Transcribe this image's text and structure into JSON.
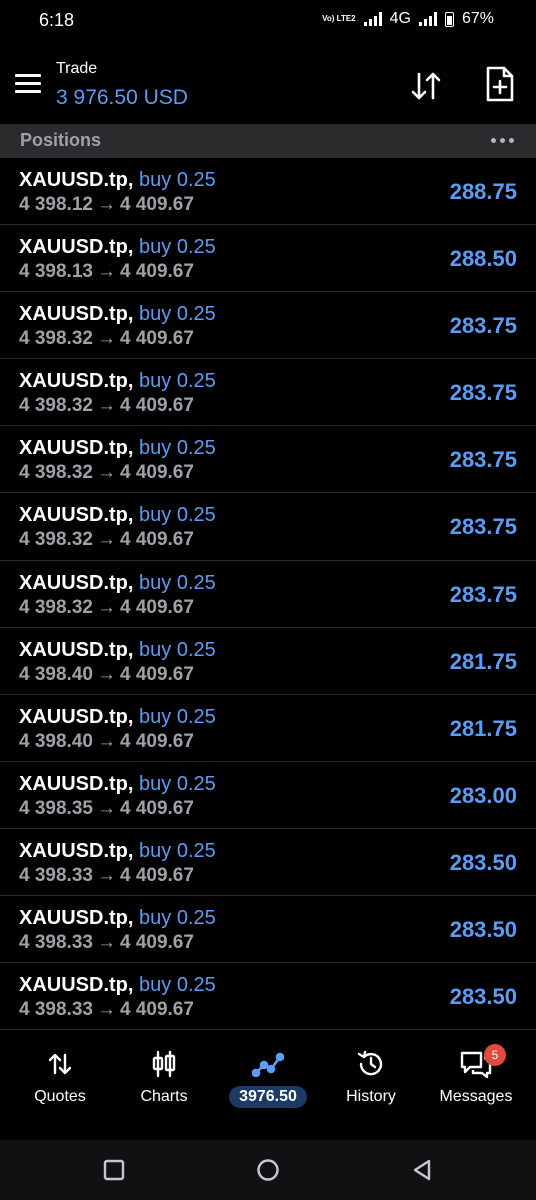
{
  "status_bar": {
    "time": "6:18",
    "volte_label": "Vo) LTE2",
    "network": "4G",
    "battery": "67%"
  },
  "header": {
    "title": "Trade",
    "balance": "3 976.50 USD"
  },
  "section": {
    "title": "Positions"
  },
  "positions": [
    {
      "symbol": "XAUUSD.tp,",
      "side": "buy 0.25",
      "open_price": "4 398.12",
      "current_price": "4 409.67",
      "profit": "288.75"
    },
    {
      "symbol": "XAUUSD.tp,",
      "side": "buy 0.25",
      "open_price": "4 398.13",
      "current_price": "4 409.67",
      "profit": "288.50"
    },
    {
      "symbol": "XAUUSD.tp,",
      "side": "buy 0.25",
      "open_price": "4 398.32",
      "current_price": "4 409.67",
      "profit": "283.75"
    },
    {
      "symbol": "XAUUSD.tp,",
      "side": "buy 0.25",
      "open_price": "4 398.32",
      "current_price": "4 409.67",
      "profit": "283.75"
    },
    {
      "symbol": "XAUUSD.tp,",
      "side": "buy 0.25",
      "open_price": "4 398.32",
      "current_price": "4 409.67",
      "profit": "283.75"
    },
    {
      "symbol": "XAUUSD.tp,",
      "side": "buy 0.25",
      "open_price": "4 398.32",
      "current_price": "4 409.67",
      "profit": "283.75"
    },
    {
      "symbol": "XAUUSD.tp,",
      "side": "buy 0.25",
      "open_price": "4 398.32",
      "current_price": "4 409.67",
      "profit": "283.75"
    },
    {
      "symbol": "XAUUSD.tp,",
      "side": "buy 0.25",
      "open_price": "4 398.40",
      "current_price": "4 409.67",
      "profit": "281.75"
    },
    {
      "symbol": "XAUUSD.tp,",
      "side": "buy 0.25",
      "open_price": "4 398.40",
      "current_price": "4 409.67",
      "profit": "281.75"
    },
    {
      "symbol": "XAUUSD.tp,",
      "side": "buy 0.25",
      "open_price": "4 398.35",
      "current_price": "4 409.67",
      "profit": "283.00"
    },
    {
      "symbol": "XAUUSD.tp,",
      "side": "buy 0.25",
      "open_price": "4 398.33",
      "current_price": "4 409.67",
      "profit": "283.50"
    },
    {
      "symbol": "XAUUSD.tp,",
      "side": "buy 0.25",
      "open_price": "4 398.33",
      "current_price": "4 409.67",
      "profit": "283.50"
    },
    {
      "symbol": "XAUUSD.tp,",
      "side": "buy 0.25",
      "open_price": "4 398.33",
      "current_price": "4 409.67",
      "profit": "283.50"
    }
  ],
  "bottom_nav": {
    "quotes_label": "Quotes",
    "charts_label": "Charts",
    "trade_label": "3976.50",
    "history_label": "History",
    "messages_label": "Messages",
    "messages_badge": "5"
  },
  "icons": {
    "menu": "menu-icon",
    "sort": "sort-arrows-icon",
    "new_order": "new-document-plus-icon",
    "more": "more-dots-icon",
    "quotes": "up-down-arrows-icon",
    "charts": "candlestick-icon",
    "trade": "trend-line-icon",
    "history": "history-clock-icon",
    "messages": "chat-bubbles-icon"
  },
  "colors": {
    "accent": "#5b9cf6",
    "background": "#000000",
    "section_bg": "#2b2b2e",
    "secondary_text": "#9da2a8",
    "badge": "#e04a3f"
  }
}
